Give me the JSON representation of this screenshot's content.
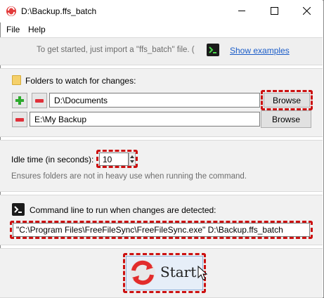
{
  "window": {
    "title": "D:\\Backup.ffs_batch",
    "minimize_glyph": "—",
    "maximize_glyph": "☐",
    "close_glyph": "✕"
  },
  "menu": {
    "items": [
      "File",
      "Help"
    ]
  },
  "hint": {
    "text": "To get started, just import a \"ffs_batch\" file.  (",
    "link": "Show examples",
    "icon": "terminal-icon"
  },
  "folders": {
    "heading": "Folders to watch for changes:",
    "rows": [
      {
        "path": "D:\\Documents",
        "browse_label": "Browse"
      },
      {
        "path": "E:\\My Backup",
        "browse_label": "Browse"
      }
    ]
  },
  "idle": {
    "label": "Idle time (in seconds):",
    "value": "10",
    "hint": "Ensures folders are not in heavy use when running the command."
  },
  "command": {
    "label": "Command line to run when changes are detected:",
    "value": "\"C:\\Program Files\\FreeFileSync\\FreeFileSync.exe\" D:\\Backup.ffs_batch"
  },
  "start": {
    "label": "Start"
  },
  "colors": {
    "accent": "#1a5cc8",
    "highlight": "#cc1111",
    "section_bg": "#f1f1f1"
  }
}
